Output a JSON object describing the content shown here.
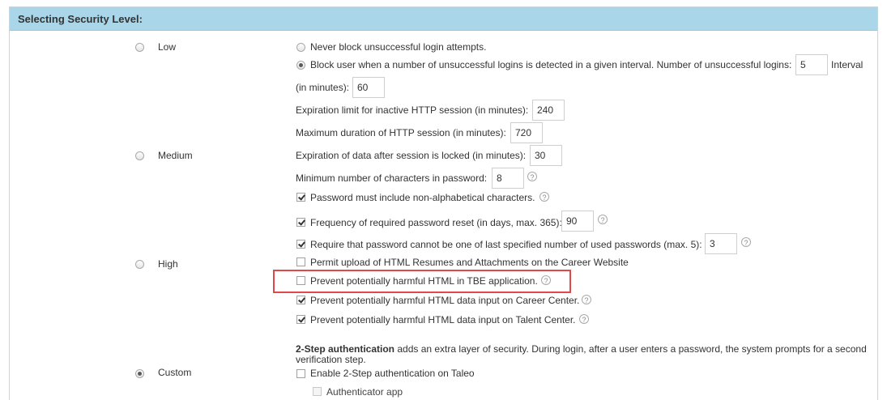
{
  "panel": {
    "title": "Selecting Security Level:"
  },
  "levels": [
    {
      "label": "Low",
      "checked": false
    },
    {
      "label": "Medium",
      "checked": false
    },
    {
      "label": "High",
      "checked": false
    },
    {
      "label": "Custom",
      "checked": true
    }
  ],
  "login": {
    "never_block_label": "Never block unsuccessful login attempts.",
    "block_label": "Block user when a number of unsuccessful logins is detected in a given interval. Number of unsuccessful logins:",
    "unsuccessful_logins_value": "5",
    "interval_label_1": "Interval",
    "interval_label_2": "(in minutes):",
    "interval_value": "60"
  },
  "session": {
    "inactive_label": "Expiration limit for inactive HTTP session (in minutes):",
    "inactive_value": "240",
    "max_duration_label": "Maximum duration of HTTP session (in minutes):",
    "max_duration_value": "720",
    "locked_label": "Expiration of data after session is locked (in minutes):",
    "locked_value": "30"
  },
  "password": {
    "min_chars_label": "Minimum number of characters in password:",
    "min_chars_value": "8",
    "non_alpha_label": "Password must include non-alphabetical characters.",
    "non_alpha_checked": true,
    "reset_label": "Frequency of required password reset (in days, max. 365):",
    "reset_checked": true,
    "reset_value": "90",
    "history_label": "Require that password cannot be one of last specified number of used passwords (max. 5):",
    "history_checked": true,
    "history_value": "3"
  },
  "html_options": [
    {
      "label": "Permit upload of HTML Resumes and Attachments on the Career Website",
      "checked": false,
      "help": false
    },
    {
      "label": "Prevent potentially harmful HTML in TBE application.",
      "checked": false,
      "help": true
    },
    {
      "label": "Prevent potentially harmful HTML data input on Career Center.",
      "checked": true,
      "help": true
    },
    {
      "label": "Prevent potentially harmful HTML data input on Talent Center.",
      "checked": true,
      "help": true
    }
  ],
  "two_step": {
    "title": "2-Step authentication",
    "description": " adds an extra layer of security. During login, after a user enters a password, the system prompts for a second verification step.",
    "enable_label": "Enable 2-Step authentication on Taleo",
    "authenticator_label": "Authenticator app"
  },
  "help_glyph": "?",
  "colors": {
    "header": "#a9d6e9",
    "highlight": "#e0484b"
  }
}
